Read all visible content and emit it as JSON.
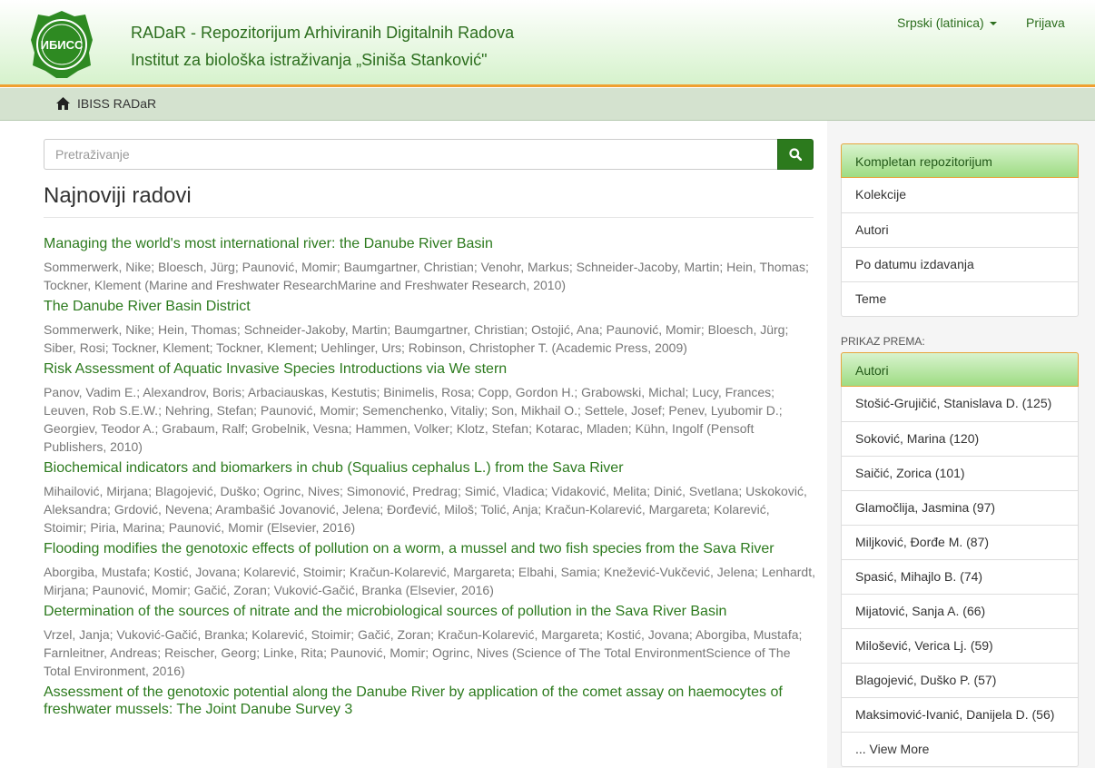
{
  "header": {
    "title_line1": "RADaR - Repozitorijum Arhiviranih Digitalnih Radova",
    "title_line2": "Institut za biološka istraživanja „Siniša Stanković\"",
    "language": "Srpski (latinica)",
    "login": "Prijava",
    "logo_text": "ИБИСС"
  },
  "breadcrumb": {
    "home": "IBISS RADaR"
  },
  "search": {
    "placeholder": "Pretraživanje"
  },
  "main": {
    "heading": "Najnoviji radovi",
    "items": [
      {
        "title": "Managing the world's most international river: the Danube River Basin",
        "meta": "Sommerwerk, Nike; Bloesch, Jürg; Paunović, Momir; Baumgartner, Christian; Venohr, Markus; Schneider-Jacoby, Martin; Hein, Thomas; Tockner, Klement (Marine and Freshwater ResearchMarine and Freshwater Research, 2010)"
      },
      {
        "title": "The Danube River Basin District",
        "meta": "Sommerwerk, Nike; Hein, Thomas; Schneider-Jakoby, Martin; Baumgartner, Christian; Ostojić, Ana; Paunović, Momir; Bloesch, Jürg; Siber, Rosi; Tockner, Klement; Tockner, Klement; Uehlinger, Urs; Robinson, Christopher T. (Academic Press, 2009)"
      },
      {
        "title": "Risk Assessment of Aquatic Invasive Species Introductions via We stern",
        "meta": "Panov, Vadim E.; Alexandrov, Boris; Arbaciauskas, Kestutis; Binimelis, Rosa; Copp, Gordon H.; Grabowski, Michal; Lucy, Frances; Leuven, Rob S.E.W.; Nehring, Stefan; Paunović, Momir; Semenchenko, Vitaliy; Son, Mikhail O.; Settele, Josef; Penev, Lyubomir D.; Georgiev, Teodor A.; Grabaum, Ralf; Grobelnik, Vesna; Hammen, Volker; Klotz, Stefan; Kotarac, Mladen; Kühn, Ingolf (Pensoft Publishers, 2010)"
      },
      {
        "title": "Biochemical indicators and biomarkers in chub (Squalius cephalus L.) from the Sava River",
        "meta": "Mihailović, Mirjana; Blagojević, Duško; Ogrinc, Nives; Simonović, Predrag; Simić, Vladica; Vidaković, Melita; Dinić, Svetlana; Uskoković, Aleksandra; Grdović, Nevena; Arambašić Jovanović, Jelena; Đorđević, Miloš; Tolić, Anja; Kračun-Kolarević, Margareta; Kolarević, Stoimir; Piria, Marina; Paunović, Momir (Elsevier, 2016)"
      },
      {
        "title": "Flooding modifies the genotoxic effects of pollution on a worm, a mussel and two fish species from the Sava River",
        "meta": "Aborgiba, Mustafa; Kostić, Jovana; Kolarević, Stoimir; Kračun-Kolarević, Margareta; Elbahi, Samia; Knežević-Vukčević, Jelena; Lenhardt, Mirjana; Paunović, Momir; Gačić, Zoran; Vuković-Gačić, Branka (Elsevier, 2016)"
      },
      {
        "title": "Determination of the sources of nitrate and the microbiological sources of pollution in the Sava River Basin",
        "meta": "Vrzel, Janja; Vuković-Gačić, Branka; Kolarević, Stoimir; Gačić, Zoran; Kračun-Kolarević, Margareta; Kostić, Jovana; Aborgiba, Mustafa; Farnleitner, Andreas; Reischer, Georg; Linke, Rita; Paunović, Momir; Ogrinc, Nives (Science of The Total EnvironmentScience of The Total Environment, 2016)"
      },
      {
        "title": "Assessment of the genotoxic potential along the Danube River by application of the comet assay on haemocytes of freshwater mussels: The Joint Danube Survey 3",
        "meta": ""
      }
    ]
  },
  "sidebar": {
    "browse": [
      "Kompletan repozitorijum",
      "Kolekcije",
      "Autori",
      "Po datumu izdavanja",
      "Teme"
    ],
    "facet_label": "PRIKAZ PREMA:",
    "facet_title": "Autori",
    "authors": [
      "Stošić-Grujičić, Stanislava D. (125)",
      "Soković, Marina (120)",
      "Saičić, Zorica (101)",
      "Glamočlija, Jasmina (97)",
      "Miljković, Đorđe M. (87)",
      "Spasić, Mihajlo B. (74)",
      "Mijatović, Sanja A. (66)",
      "Milošević, Verica Lj. (59)",
      "Blagojević, Duško P. (57)",
      "Maksimović-Ivanić, Danijela D. (56)"
    ],
    "view_more": "... View More"
  },
  "colors": {
    "brand_green": "#2c7a1d",
    "accent_orange": "#f0a030"
  }
}
